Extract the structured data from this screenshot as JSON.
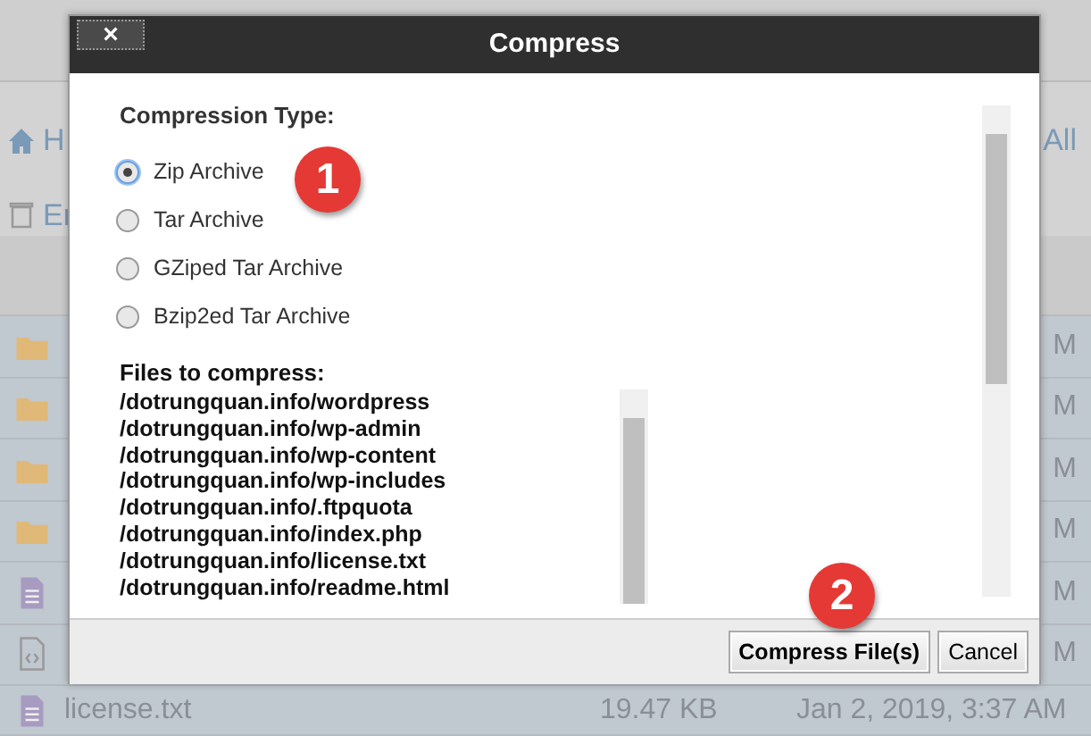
{
  "background": {
    "toolbar_left": [
      "H",
      "Er"
    ],
    "toolbar_right": "All",
    "rows": [
      {
        "kind": "folder",
        "time": "M"
      },
      {
        "kind": "folder",
        "time": "M"
      },
      {
        "kind": "folder",
        "time": "M"
      },
      {
        "kind": "folder",
        "time": "M"
      },
      {
        "kind": "file",
        "time": "M"
      },
      {
        "kind": "code",
        "time": "M"
      }
    ],
    "last_row": {
      "name": "license.txt",
      "size": "19.47 KB",
      "date": "Jan 2, 2019, 3:37 AM"
    }
  },
  "dialog": {
    "title": "Compress",
    "close": "×",
    "compression_label": "Compression Type:",
    "options": [
      {
        "label": "Zip Archive",
        "selected": true
      },
      {
        "label": "Tar Archive",
        "selected": false
      },
      {
        "label": "GZiped Tar Archive",
        "selected": false
      },
      {
        "label": "Bzip2ed Tar Archive",
        "selected": false
      }
    ],
    "files_label": "Files to compress:",
    "files": [
      "/dotrungquan.info/wordpress",
      "/dotrungquan.info/wp-admin",
      "/dotrungquan.info/wp-content",
      "/dotrungquan.info/wp-includes",
      "/dotrungquan.info/.ftpquota",
      "/dotrungquan.info/index.php",
      "/dotrungquan.info/license.txt",
      "/dotrungquan.info/readme.html"
    ],
    "buttons": [
      {
        "label": "Compress File(s)",
        "kind": "primary"
      },
      {
        "label": "Cancel",
        "kind": "secondary"
      }
    ]
  },
  "callouts": [
    "1",
    "2"
  ]
}
